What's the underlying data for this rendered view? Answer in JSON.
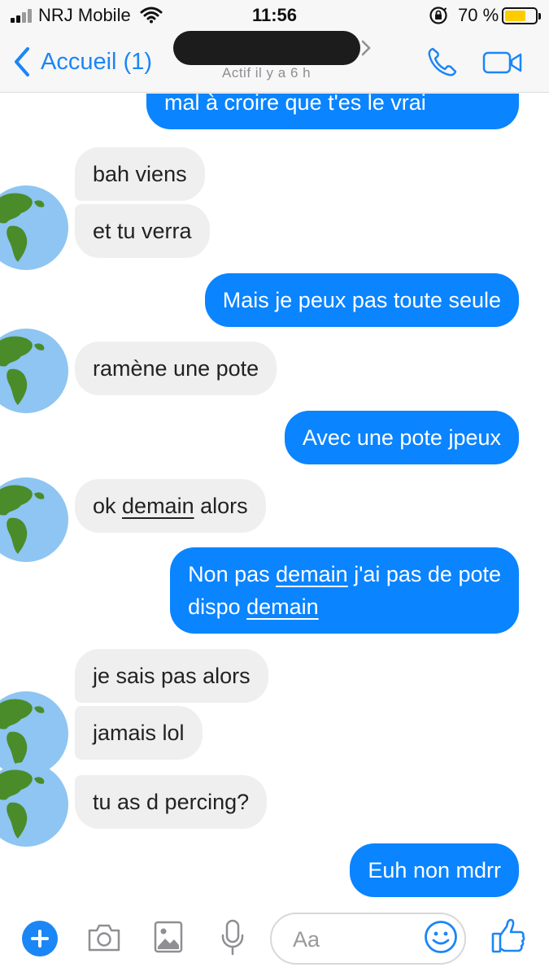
{
  "status_bar": {
    "carrier": "NRJ Mobile",
    "time": "11:56",
    "battery_percent": "70 %",
    "battery_level": 0.7,
    "icons": [
      "signal-icon",
      "wifi-icon",
      "rotation-lock-icon",
      "battery-icon"
    ]
  },
  "nav": {
    "back_label": "Accueil (1)",
    "contact_name": "",
    "active_status": "Actif il y a 6 h",
    "icons": [
      "back-chevron-icon",
      "phone-icon",
      "video-camera-icon"
    ]
  },
  "messages": [
    {
      "id": 0,
      "direction": "outgoing",
      "text": "mal à croire que t'es le vrai"
    },
    {
      "id": 1,
      "direction": "incoming",
      "text": "bah viens"
    },
    {
      "id": 2,
      "direction": "incoming",
      "text": "et tu verra"
    },
    {
      "id": 3,
      "direction": "outgoing",
      "text": "Mais je peux pas toute seule"
    },
    {
      "id": 4,
      "direction": "incoming",
      "text": "ramène une pote"
    },
    {
      "id": 5,
      "direction": "outgoing",
      "text": "Avec une pote jpeux"
    },
    {
      "id": 6,
      "direction": "incoming",
      "parts": [
        "ok ",
        "demain",
        " alors"
      ],
      "underlined": [
        "demain"
      ]
    },
    {
      "id": 7,
      "direction": "outgoing",
      "lines": [
        [
          "Non pas ",
          "demain",
          " j'ai pas de pote"
        ],
        [
          "dispo ",
          "demain"
        ]
      ],
      "underlined": [
        "demain"
      ]
    },
    {
      "id": 8,
      "direction": "incoming",
      "text": "je sais pas alors"
    },
    {
      "id": 9,
      "direction": "incoming",
      "text": "jamais lol"
    },
    {
      "id": 10,
      "direction": "incoming",
      "text": "tu as d percing?"
    },
    {
      "id": 11,
      "direction": "outgoing",
      "text": "Euh non mdrr"
    }
  ],
  "composer": {
    "placeholder": "Aa",
    "icons": [
      "plus-icon",
      "camera-icon",
      "image-icon",
      "microphone-icon",
      "emoji-icon",
      "thumbs-up-icon"
    ]
  },
  "colors": {
    "accent": "#1b86f6",
    "outgoing_bubble": "#0a84ff",
    "incoming_bubble": "#efefef",
    "battery_fill": "#ffcc00"
  }
}
